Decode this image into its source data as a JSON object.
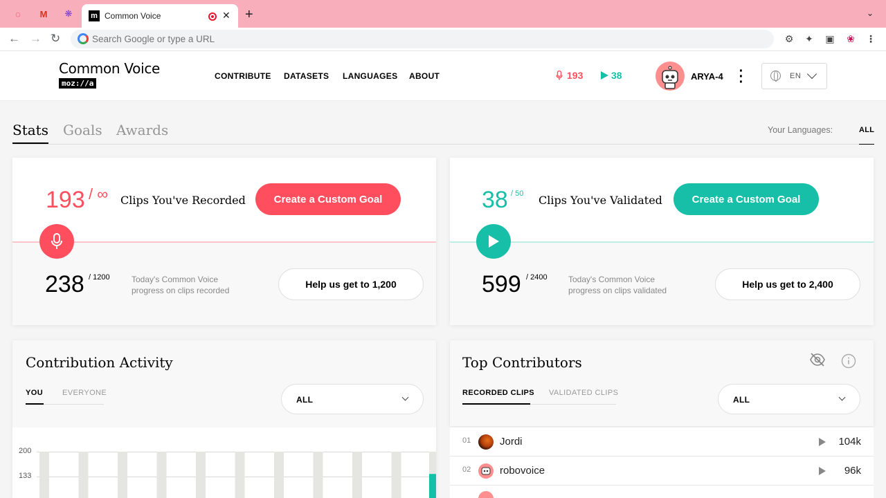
{
  "browser": {
    "tab_title": "Common Voice",
    "omnibox_placeholder": "Search Google or type a URL"
  },
  "header": {
    "brand_title": "Common Voice",
    "brand_sub": "moz://a",
    "nav": [
      "CONTRIBUTE",
      "DATASETS",
      "LANGUAGES",
      "ABOUT"
    ],
    "recorded_count": "193",
    "validated_count": "38",
    "username": "ARYA-4",
    "language": "EN"
  },
  "page_tabs": [
    "Stats",
    "Goals",
    "Awards"
  ],
  "your_languages": {
    "label": "Your Languages:",
    "value": "ALL"
  },
  "recorded_card": {
    "count": "193",
    "goal": "/ ∞",
    "label": "Clips You've Recorded",
    "button": "Create a Custom Goal",
    "today_count": "238",
    "today_goal": "/ 1200",
    "today_text_line1": "Today's Common Voice",
    "today_text_line2": "progress on clips recorded",
    "help_button": "Help us get to 1,200",
    "accent": "#ff4f5e"
  },
  "validated_card": {
    "count": "38",
    "goal": "/ 50",
    "label": "Clips You've Validated",
    "button": "Create a Custom Goal",
    "today_count": "599",
    "today_goal": "/ 2400",
    "today_text_line1": "Today's Common Voice",
    "today_text_line2": "progress on clips validated",
    "help_button": "Help us get to 2,400",
    "accent": "#17bfa8"
  },
  "activity": {
    "title": "Contribution Activity",
    "tabs": [
      "YOU",
      "EVERYONE"
    ],
    "filter": "ALL"
  },
  "chart_data": {
    "type": "bar",
    "y_ticks": [
      "200",
      "133"
    ],
    "ylim": [
      0,
      200
    ],
    "bar_count": 10,
    "highlight_value": 140
  },
  "contributors": {
    "title": "Top Contributors",
    "tabs": [
      "RECORDED CLIPS",
      "VALIDATED CLIPS"
    ],
    "filter": "ALL",
    "rows": [
      {
        "rank": "01",
        "name": "Jordi",
        "count": "104k"
      },
      {
        "rank": "02",
        "name": "robovoice",
        "count": "96k"
      }
    ]
  }
}
